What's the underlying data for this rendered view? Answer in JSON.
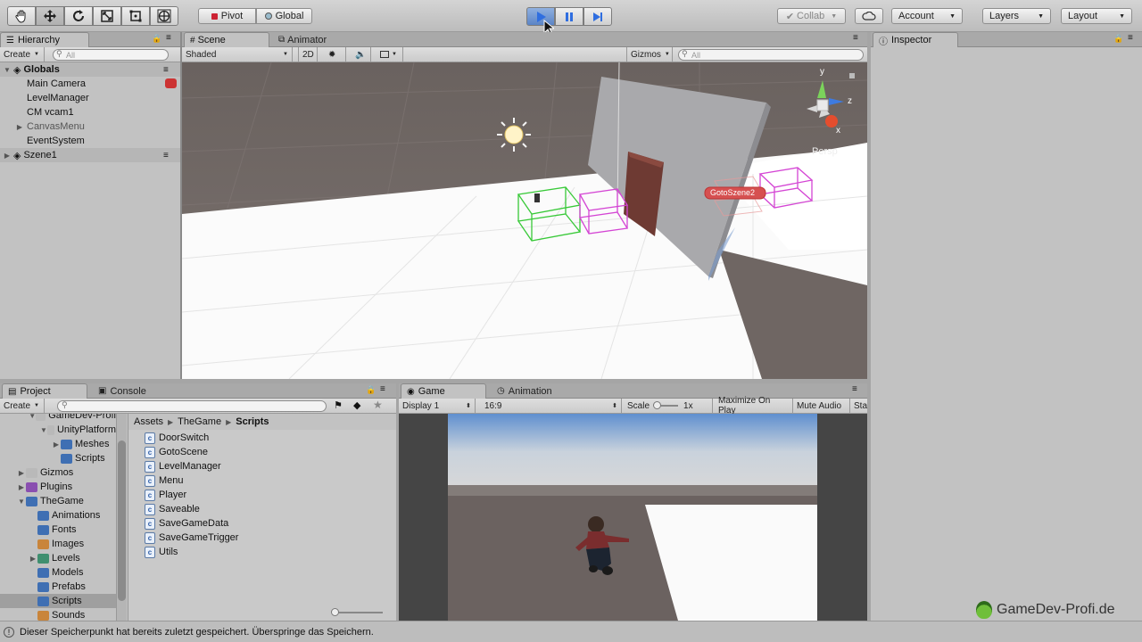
{
  "toolbar": {
    "pivot": "Pivot",
    "global": "Global",
    "collab": "Collab",
    "account": "Account",
    "layers": "Layers",
    "layout": "Layout"
  },
  "hierarchy": {
    "tab": "Hierarchy",
    "create": "Create",
    "search_placeholder": "All",
    "scene_root": "Globals",
    "items": [
      "Main Camera",
      "LevelManager",
      "CM vcam1",
      "CanvasMenu",
      "EventSystem"
    ],
    "scene2": "Szene1"
  },
  "scene_view": {
    "tab_scene": "Scene",
    "tab_animator": "Animator",
    "shading": "Shaded",
    "mode_2d": "2D",
    "gizmos": "Gizmos",
    "search_placeholder": "All",
    "persp": "Persp",
    "axis_y": "y",
    "axis_z": "z",
    "axis_x": "x",
    "label_goto": "GotoSzene2"
  },
  "inspector": {
    "tab": "Inspector"
  },
  "project": {
    "tab_project": "Project",
    "tab_console": "Console",
    "create": "Create",
    "tree": [
      {
        "label": "GameDev-Profi",
        "indent": 2,
        "arrow": "▼",
        "color": "#b9b9b9"
      },
      {
        "label": "UnityPlatform",
        "indent": 3,
        "arrow": "▼",
        "color": "#b9b9b9"
      },
      {
        "label": "Meshes",
        "indent": 4,
        "arrow": "▶",
        "color": "#3f6fb3"
      },
      {
        "label": "Scripts",
        "indent": 4,
        "arrow": "",
        "color": "#3f6fb3"
      },
      {
        "label": "Gizmos",
        "indent": 1,
        "arrow": "▶",
        "color": "#b9b9b9"
      },
      {
        "label": "Plugins",
        "indent": 1,
        "arrow": "▶",
        "color": "#8a4fb0"
      },
      {
        "label": "TheGame",
        "indent": 1,
        "arrow": "▼",
        "color": "#3f6fb3"
      },
      {
        "label": "Animations",
        "indent": 2,
        "arrow": "",
        "color": "#3f6fb3"
      },
      {
        "label": "Fonts",
        "indent": 2,
        "arrow": "",
        "color": "#3f6fb3"
      },
      {
        "label": "Images",
        "indent": 2,
        "arrow": "",
        "color": "#c9853b"
      },
      {
        "label": "Levels",
        "indent": 2,
        "arrow": "▶",
        "color": "#3f8f6f"
      },
      {
        "label": "Models",
        "indent": 2,
        "arrow": "",
        "color": "#3f6fb3"
      },
      {
        "label": "Prefabs",
        "indent": 2,
        "arrow": "",
        "color": "#3f6fb3"
      },
      {
        "label": "Scripts",
        "indent": 2,
        "arrow": "",
        "color": "#3f6fb3",
        "selected": true
      },
      {
        "label": "Sounds",
        "indent": 2,
        "arrow": "",
        "color": "#c9853b"
      }
    ],
    "breadcrumb": [
      "Assets",
      "TheGame",
      "Scripts"
    ],
    "files": [
      "DoorSwitch",
      "GotoScene",
      "LevelManager",
      "Menu",
      "Player",
      "Saveable",
      "SaveGameData",
      "SaveGameTrigger",
      "Utils"
    ]
  },
  "game_view": {
    "tab_game": "Game",
    "tab_animation": "Animation",
    "display": "Display 1",
    "aspect": "16:9",
    "scale_label": "Scale",
    "scale_value": "1x",
    "maximize": "Maximize On Play",
    "mute": "Mute Audio",
    "stats": "Stat"
  },
  "watermark": "GameDev-Profi.de",
  "status_bar": "Dieser Speicherpunkt hat bereits zuletzt gespeichert. Überspringe das Speichern.",
  "colors": {
    "accent_play": "#3f78d8",
    "selection": "#8fb4e9"
  }
}
